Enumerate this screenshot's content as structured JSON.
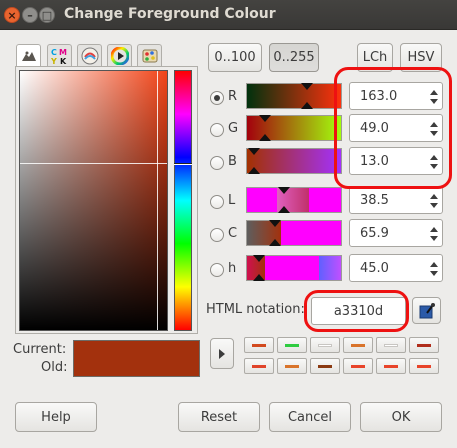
{
  "window": {
    "title": "Change Foreground Colour"
  },
  "range_buttons": {
    "r100": "0..100",
    "r255": "0..255"
  },
  "mode_buttons": {
    "lch": "LCh",
    "hsv": "HSV"
  },
  "channels": [
    {
      "label": "R",
      "value": "163.0",
      "selected": true
    },
    {
      "label": "G",
      "value": "49.0",
      "selected": false
    },
    {
      "label": "B",
      "value": "13.0",
      "selected": false
    },
    {
      "label": "L",
      "value": "38.5",
      "selected": false
    },
    {
      "label": "C",
      "value": "65.9",
      "selected": false
    },
    {
      "label": "h",
      "value": "45.0",
      "selected": false
    }
  ],
  "html_notation": {
    "label": "HTML notation:",
    "value": "a3310d"
  },
  "preview": {
    "current_label": "Current:",
    "old_label": "Old:",
    "color": "#a3310d"
  },
  "history": [
    "#d24a1e",
    "#2ecc40",
    "#ffffff",
    "#d9742b",
    "#ffffff",
    "#b02d1b",
    "#e0442a",
    "#d9742b",
    "#8b3a12",
    "#e8442a",
    "#e8442a",
    "#e8442a"
  ],
  "icons": [
    "wilber-icon",
    "cmyk-icon",
    "watercolor-icon",
    "wheel-icon",
    "palette-icon",
    "eyedropper-icon",
    "expand-arrow-icon"
  ],
  "footer": {
    "help": "Help",
    "reset": "Reset",
    "cancel": "Cancel",
    "ok": "OK"
  }
}
